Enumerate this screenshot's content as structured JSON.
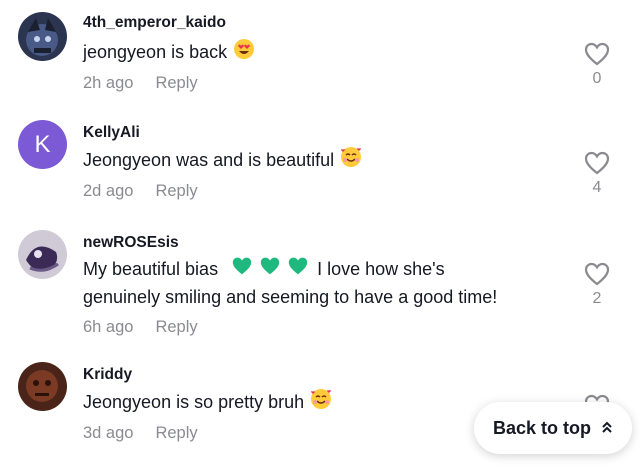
{
  "comments": [
    {
      "username": "4th_emperor_kaido",
      "text": "jeongyeon is back",
      "time": "2h ago",
      "reply": "Reply",
      "likes": "0"
    },
    {
      "username": "KellyAli",
      "avatar_letter": "K",
      "text": "Jeongyeon was and is beautiful",
      "time": "2d ago",
      "reply": "Reply",
      "likes": "4"
    },
    {
      "username": "newROSEsis",
      "text_line1_a": "My beautiful bias",
      "text_line1_b": "I love how she's",
      "text_line2": "genuinely smiling and seeming to have a good time!",
      "time": "6h ago",
      "reply": "Reply",
      "likes": "2"
    },
    {
      "username": "Kriddy",
      "text": "Jeongyeon is so pretty bruh",
      "time": "3d ago",
      "reply": "Reply"
    }
  ],
  "back_to_top": {
    "label": "Back to top"
  },
  "colors": {
    "avatar_purple": "#7c5ad6",
    "muted": "#8a8b91",
    "green_heart": "#1fb97f"
  }
}
